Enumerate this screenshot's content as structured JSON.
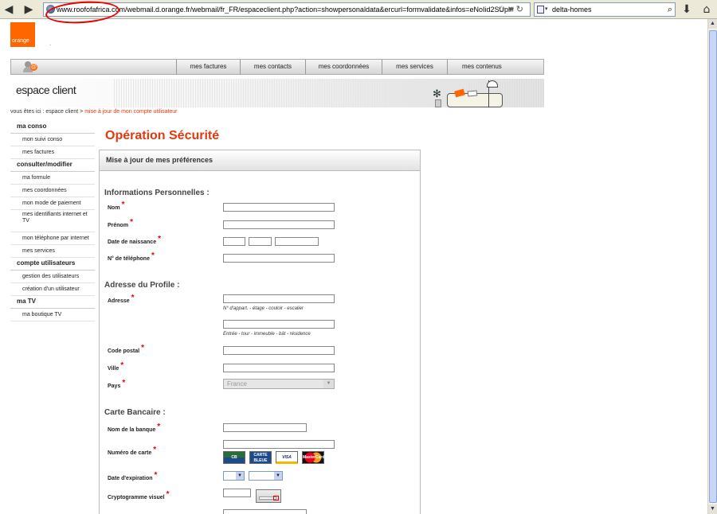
{
  "browser": {
    "url": "www.roofofafrica.com/webmail.d.orange.fr/webmail/fr_FR/espaceclient.php?action=showpersonaldata&ercurl=formvalidate&infos=eNoIid2SUpl#",
    "search_value": "delta-homes"
  },
  "logo": {
    "text": "orange",
    "dot": "."
  },
  "top_menu": [
    "mes factures",
    "mes contacts",
    "mes coordonnées",
    "mes services",
    "mes contenus"
  ],
  "banner": {
    "title": "espace client"
  },
  "breadcrumb": {
    "prefix": "vous êtes ici : espace client  >  ",
    "current": "mise à jour de mon compte utilisateur"
  },
  "sidebar": {
    "sections": [
      {
        "title": "ma conso",
        "items": [
          "mon suivi conso",
          "mes factures"
        ]
      },
      {
        "title": "consulter/modifier",
        "items": [
          "ma formule",
          "mes coordonnées",
          "mon mode de paiement",
          "mes identifiants internet et TV",
          "mon téléphone par internet",
          "mes services"
        ]
      },
      {
        "title": "compte utilisateurs",
        "items": [
          "gestion des utilisateurs",
          "création d'un utilisateur"
        ]
      },
      {
        "title": "ma TV",
        "items": [
          "ma boutique TV"
        ]
      }
    ]
  },
  "form": {
    "page_title": "Opération Sécurité",
    "header": "Mise à jour de mes préférences",
    "required_mark": "*",
    "sections": {
      "personal": "Informations Personnelles :",
      "address": "Adresse du Profile :",
      "card": "Carte Bancaire :"
    },
    "labels": {
      "nom": "Nom",
      "prenom": "Prénom",
      "naissance": "Date de naissance",
      "telephone": "N° de téléphone",
      "adresse": "Adresse",
      "code_postal": "Code postal",
      "ville": "Ville",
      "pays": "Pays",
      "banque": "Nom de la banque",
      "numero_carte": "Numéro de carte",
      "expiration": "Date d'expiration",
      "crypto": "Cryptogramme visuel"
    },
    "hints": {
      "adresse1": "N° d'appart. - étage - couloir - escalier",
      "adresse2": "Entrée - tour - immeuble - bât - résidence"
    },
    "pays_value": "France",
    "card_logos": [
      "CB",
      "CARTE BLEUE",
      "VISA",
      "MasterCard"
    ]
  }
}
